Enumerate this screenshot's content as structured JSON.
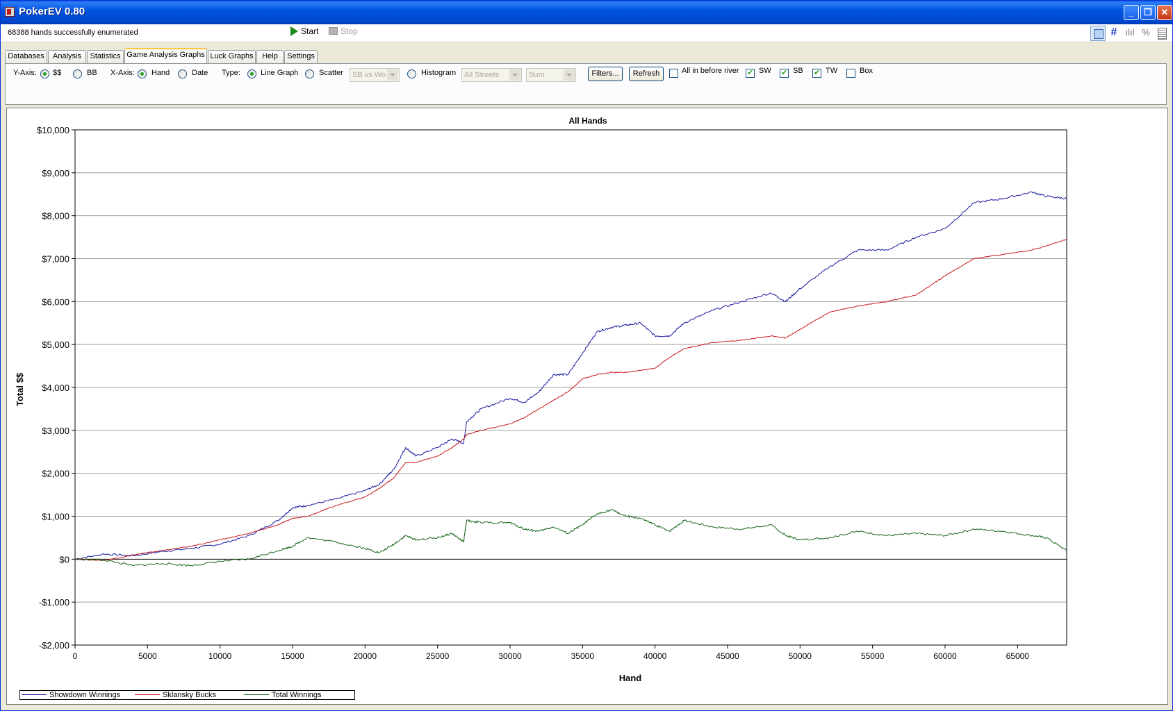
{
  "window": {
    "title": "PokerEV 0.80",
    "buttons": {
      "minimize": "_",
      "maximize": "❐",
      "close": "✕"
    }
  },
  "status": {
    "message": "68388 hands successfully enumerated",
    "start_label": "Start",
    "stop_label": "Stop"
  },
  "toolbar_icons": [
    "image-view-icon",
    "grid-icon",
    "bar-chart-icon",
    "percent-icon",
    "document-icon"
  ],
  "toolbar_icon_text": {
    "grid": "#",
    "bars": "ılıl",
    "percent": "%"
  },
  "tabs": [
    {
      "label": "Databases",
      "active": false
    },
    {
      "label": "Analysis",
      "active": false
    },
    {
      "label": "Statistics",
      "active": false
    },
    {
      "label": "Game Analysis Graphs",
      "active": true
    },
    {
      "label": "Luck Graphs",
      "active": false
    },
    {
      "label": "Help",
      "active": false
    },
    {
      "label": "Settings",
      "active": false
    }
  ],
  "controls": {
    "yaxis_label": "Y-Axis:",
    "yaxis_options": [
      {
        "label": "$$",
        "selected": true
      },
      {
        "label": "BB",
        "selected": false
      }
    ],
    "xaxis_label": "X-Axis:",
    "xaxis_options": [
      {
        "label": "Hand",
        "selected": true
      },
      {
        "label": "Date",
        "selected": false
      }
    ],
    "type_label": "Type:",
    "type_options": [
      {
        "label": "Line Graph",
        "selected": true
      },
      {
        "label": "Scatter",
        "selected": false
      },
      {
        "label": "Histogram",
        "selected": false
      }
    ],
    "scatter_combo": "SB vs Wo",
    "streets_combo": "All Streets",
    "agg_combo": "Sum",
    "filters_button": "Filters...",
    "refresh_button": "Refresh",
    "checks": [
      {
        "label": "All in before river",
        "checked": false
      },
      {
        "label": "SW",
        "checked": true
      },
      {
        "label": "SB",
        "checked": true
      },
      {
        "label": "TW",
        "checked": true
      },
      {
        "label": "Box",
        "checked": false
      }
    ]
  },
  "chart_data": {
    "type": "line",
    "title": "All Hands",
    "xlabel": "Hand",
    "ylabel": "Total $$",
    "xlim": [
      0,
      68388
    ],
    "ylim": [
      -2000,
      10000
    ],
    "x_ticks": [
      0,
      5000,
      10000,
      15000,
      20000,
      25000,
      30000,
      35000,
      40000,
      45000,
      50000,
      55000,
      60000,
      65000
    ],
    "x_tick_labels": [
      "0",
      "5000",
      "10000",
      "15000",
      "20000",
      "25000",
      "30000",
      "35000",
      "40000",
      "45000",
      "50000",
      "55000",
      "60000",
      "65000"
    ],
    "y_ticks": [
      -2000,
      -1000,
      0,
      1000,
      2000,
      3000,
      4000,
      5000,
      6000,
      7000,
      8000,
      9000,
      10000
    ],
    "y_tick_labels": [
      "-$2,000",
      "-$1,000",
      "$0",
      "$1,000",
      "$2,000",
      "$3,000",
      "$4,000",
      "$5,000",
      "$6,000",
      "$7,000",
      "$8,000",
      "$9,000",
      "$10,000"
    ],
    "grid": "horizontal",
    "legend_position": "bottom-left",
    "x": [
      0,
      2000,
      4000,
      6000,
      8000,
      10000,
      12000,
      14000,
      15000,
      16000,
      18000,
      20000,
      21000,
      22000,
      22800,
      23500,
      25000,
      26000,
      26800,
      27000,
      28000,
      30000,
      31000,
      32000,
      33000,
      34000,
      35000,
      36000,
      37000,
      38000,
      39000,
      40000,
      41000,
      42000,
      44000,
      46000,
      48000,
      49000,
      50000,
      52000,
      54000,
      56000,
      58000,
      60000,
      62000,
      64000,
      66000,
      67000,
      68388
    ],
    "series": [
      {
        "name": "Showdown Winnings",
        "color": "#1414a0",
        "values": [
          0,
          120,
          80,
          180,
          250,
          350,
          550,
          900,
          1200,
          1250,
          1400,
          1600,
          1750,
          2100,
          2600,
          2400,
          2600,
          2800,
          2700,
          3200,
          3500,
          3750,
          3650,
          3900,
          4300,
          4300,
          4800,
          5300,
          5400,
          5450,
          5500,
          5200,
          5200,
          5500,
          5800,
          6000,
          6200,
          6000,
          6300,
          6800,
          7200,
          7200,
          7500,
          7700,
          8300,
          8400,
          8550,
          8450,
          8400
        ]
      },
      {
        "name": "Sklansky Bucks",
        "color": "#c81414",
        "values": [
          0,
          -30,
          100,
          200,
          300,
          450,
          600,
          800,
          950,
          1000,
          1250,
          1450,
          1650,
          1900,
          2250,
          2250,
          2400,
          2600,
          2800,
          2900,
          3000,
          3150,
          3300,
          3500,
          3700,
          3900,
          4200,
          4300,
          4350,
          4350,
          4400,
          4450,
          4700,
          4900,
          5050,
          5100,
          5200,
          5150,
          5350,
          5750,
          5900,
          6000,
          6150,
          6600,
          7000,
          7100,
          7200,
          7300,
          7450
        ]
      },
      {
        "name": "Total Winnings",
        "color": "#146414",
        "values": [
          0,
          -20,
          -150,
          -100,
          -150,
          -50,
          0,
          200,
          300,
          500,
          400,
          250,
          150,
          350,
          550,
          450,
          500,
          600,
          400,
          900,
          850,
          850,
          700,
          650,
          750,
          600,
          800,
          1050,
          1150,
          1000,
          950,
          800,
          650,
          900,
          750,
          700,
          800,
          550,
          450,
          500,
          650,
          550,
          600,
          550,
          700,
          650,
          550,
          500,
          200
        ]
      }
    ]
  }
}
